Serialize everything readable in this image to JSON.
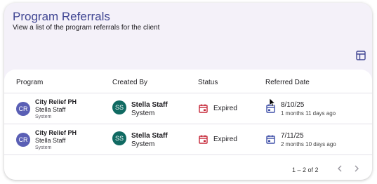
{
  "header": {
    "title": "Program Referrals",
    "subtitle": "View a list of the program referrals for the client",
    "table_toggle_icon": "table-view-icon"
  },
  "table": {
    "columns": [
      "Program",
      "Created By",
      "Status",
      "Referred Date"
    ],
    "rows": [
      {
        "program_initials": "CR",
        "program_name": "City Relief PH",
        "program_person": "Stella Staff",
        "program_type": "System",
        "creator_initials": "SS",
        "creator_name": "Stella Staff",
        "creator_role": "System",
        "status": "Expired",
        "date": "8/10/25",
        "date_relative": "1 months 11 days ago"
      },
      {
        "program_initials": "CR",
        "program_name": "City Relief PH",
        "program_person": "Stella Staff",
        "program_type": "System",
        "creator_initials": "SS",
        "creator_name": "Stella Staff",
        "creator_role": "System",
        "status": "Expired",
        "date": "7/11/25",
        "date_relative": "2 months 10 days ago"
      }
    ]
  },
  "pagination": {
    "label": "1 – 2 of 2"
  },
  "colors": {
    "title": "#3f4592",
    "status_expired": "#c62839",
    "date_icon": "#3f4fa8",
    "program_avatar": "#5a5fb5",
    "creator_avatar": "#106a62"
  }
}
